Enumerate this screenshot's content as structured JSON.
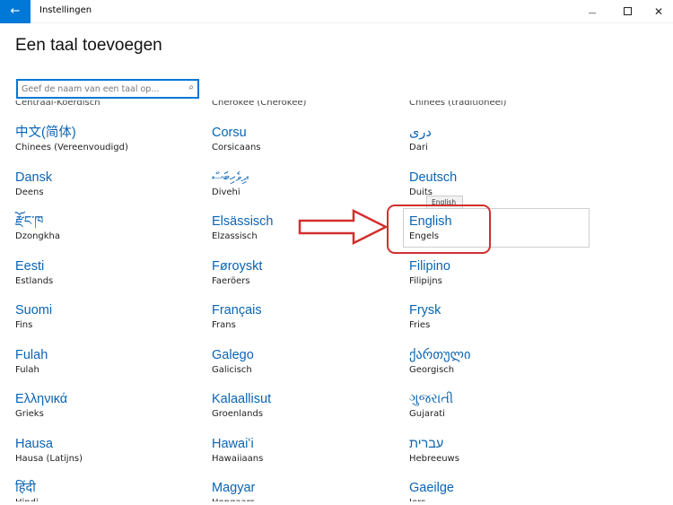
{
  "window": {
    "back_glyph": "←",
    "title": "Instellingen",
    "minimize_glyph": "—",
    "close_glyph": "✕"
  },
  "page": {
    "title": "Een taal toevoegen"
  },
  "search": {
    "placeholder": "Geef de naam van een taal op...",
    "icon": "search-icon"
  },
  "cut_off_row": [
    "Centraal-Koerdisch",
    "Cherokee (Cherokee)",
    "Chinees (traditioneel)"
  ],
  "languages": [
    {
      "native": "中文(简体)",
      "dutch": "Chinees (Vereenvoudigd)"
    },
    {
      "native": "Corsu",
      "dutch": "Corsicaans"
    },
    {
      "native": "دری",
      "dutch": "Dari"
    },
    {
      "native": "Dansk",
      "dutch": "Deens"
    },
    {
      "native": "ދިވެހިބަސް",
      "dutch": "Divehi"
    },
    {
      "native": "Deutsch",
      "dutch": "Duits"
    },
    {
      "native": "རྫོང་ཁ",
      "dutch": "Dzongkha"
    },
    {
      "native": "Elsässisch",
      "dutch": "Elzassisch"
    },
    {
      "native": "English",
      "dutch": "Engels"
    },
    {
      "native": "Eesti",
      "dutch": "Estlands"
    },
    {
      "native": "Føroyskt",
      "dutch": "Faeröers"
    },
    {
      "native": "Filipino",
      "dutch": "Filipijns"
    },
    {
      "native": "Suomi",
      "dutch": "Fins"
    },
    {
      "native": "Français",
      "dutch": "Frans"
    },
    {
      "native": "Frysk",
      "dutch": "Fries"
    },
    {
      "native": "Fulah",
      "dutch": "Fulah"
    },
    {
      "native": "Galego",
      "dutch": "Galicisch"
    },
    {
      "native": "ქართული",
      "dutch": "Georgisch"
    },
    {
      "native": "Ελληνικά",
      "dutch": "Grieks"
    },
    {
      "native": "Kalaallisut",
      "dutch": "Groenlands"
    },
    {
      "native": "ગુજરાતી",
      "dutch": "Gujarati"
    },
    {
      "native": "Hausa",
      "dutch": "Hausa (Latijns)"
    },
    {
      "native": "Hawaiʻi",
      "dutch": "Hawaiiaans"
    },
    {
      "native": "עברית",
      "dutch": "Hebreeuws"
    },
    {
      "native": "हिंदी",
      "dutch": "Hindi"
    },
    {
      "native": "Magyar",
      "dutch": "Hongaars"
    },
    {
      "native": "Gaeilge",
      "dutch": "Iers"
    }
  ],
  "tooltip": {
    "text": "English"
  },
  "colors": {
    "accent": "#0078d7",
    "link": "#0a64b4",
    "annotation": "#d32f2f"
  }
}
